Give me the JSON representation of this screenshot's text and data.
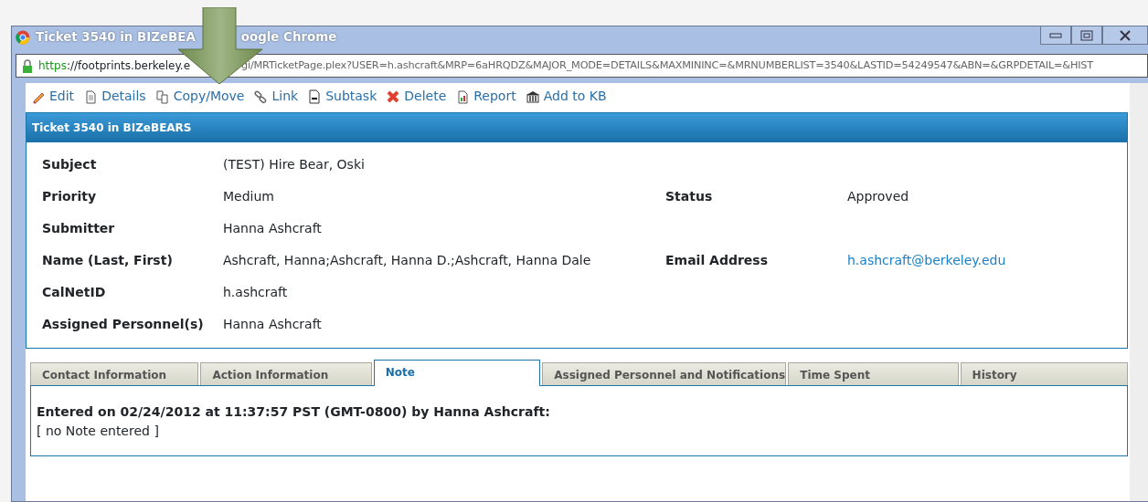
{
  "window": {
    "title_parts": [
      "Ticket 3540 in BIZeBEA",
      "oogle Chrome"
    ]
  },
  "address_bar": {
    "url_parts": [
      "https://footprints.berkeley.e",
      "gi/MRTicketPage.plex?USER=h.ashcraft&MRP=6aHRQDZ&MAJOR_MODE=DETAILS&MAXMININC=&MRNUMBERLIST=3540&LASTID=54249547&ABN=&GRPDETAIL=&HIST"
    ]
  },
  "toolbar": [
    {
      "kind": "edit",
      "label": "Edit"
    },
    {
      "kind": "details",
      "label": "Details"
    },
    {
      "kind": "copy",
      "label": "Copy/Move"
    },
    {
      "kind": "link",
      "label": "Link"
    },
    {
      "kind": "subtask",
      "label": "Subtask"
    },
    {
      "kind": "delete",
      "label": "Delete"
    },
    {
      "kind": "report",
      "label": "Report"
    },
    {
      "kind": "kb",
      "label": "Add to KB"
    }
  ],
  "panel": {
    "title": "Ticket 3540 in BIZeBEARS",
    "rows": [
      {
        "label": "Subject",
        "value": "(TEST) Hire Bear, Oski"
      },
      {
        "label": "Priority",
        "value": "Medium",
        "label_2": "Status",
        "value_2": "Approved"
      },
      {
        "label": "Submitter",
        "value": "Hanna Ashcraft"
      },
      {
        "label": "Name (Last, First)",
        "value": "Ashcraft, Hanna;Ashcraft, Hanna D.;Ashcraft, Hanna Dale",
        "label_2": "Email Address",
        "value_2": "h.ashcraft@berkeley.edu",
        "value_2_link": true
      },
      {
        "label": "CalNetID",
        "value": "h.ashcraft"
      },
      {
        "label": "Assigned Personnel(s)",
        "value": "Hanna Ashcraft"
      }
    ]
  },
  "tabs": [
    {
      "label": "Contact Information",
      "selected": false
    },
    {
      "label": "Action Information",
      "selected": false
    },
    {
      "label": "Note",
      "selected": true
    },
    {
      "label": "Assigned Personnel and Notifications",
      "selected": false
    },
    {
      "label": "Time Spent",
      "selected": false
    },
    {
      "label": "History",
      "selected": false
    }
  ],
  "note": {
    "heading": "Entered on 02/24/2012 at 11:37:57 PST (GMT-0800) by Hanna Ashcraft:",
    "text": "[ no Note entered ]"
  },
  "annotations": [
    {
      "kind": "arrow"
    }
  ]
}
